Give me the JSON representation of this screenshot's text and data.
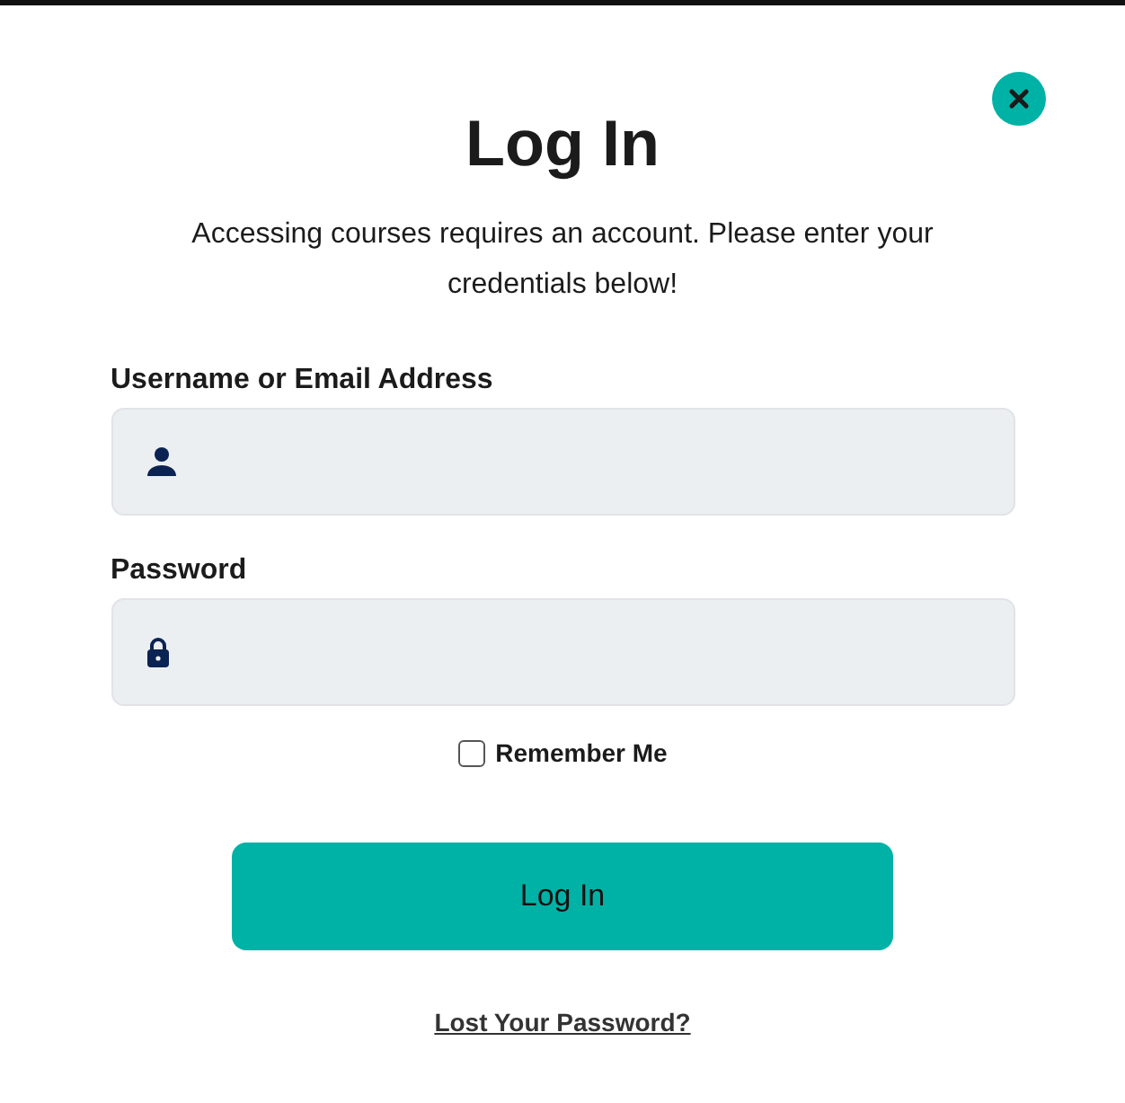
{
  "dialog": {
    "title": "Log In",
    "intro": "Accessing courses requires an account. Please enter your credentials below!"
  },
  "fields": [
    {
      "kind": "user",
      "label": "Username or Email Address"
    },
    {
      "kind": "lock",
      "label": "Password"
    }
  ],
  "remember": {
    "label": "Remember Me",
    "checked": false
  },
  "submit": "Log In",
  "lost_password": "Lost Your Password?"
}
